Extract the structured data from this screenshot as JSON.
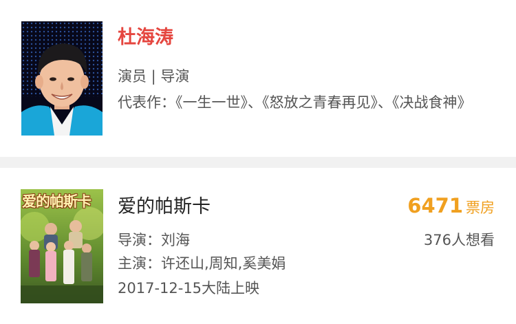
{
  "person": {
    "name": "杜海涛",
    "roles": "演员 | 导演",
    "works": "代表作：《一生一世》、《怒放之青春再见》、《决战食神》"
  },
  "movie": {
    "poster_title": "爱的帕斯卡",
    "title": "爱的帕斯卡",
    "director": "导演：刘海",
    "cast": "主演：许还山,周知,奚美娟",
    "release": "2017-12-15大陆上映",
    "box_office_value": "6471",
    "box_office_unit": "票房",
    "want_to_see": "376人想看"
  },
  "colors": {
    "name_red": "#e5463f",
    "box_office_orange": "#f0a020",
    "text_gray": "#555555",
    "divider": "#f1f1f1"
  }
}
